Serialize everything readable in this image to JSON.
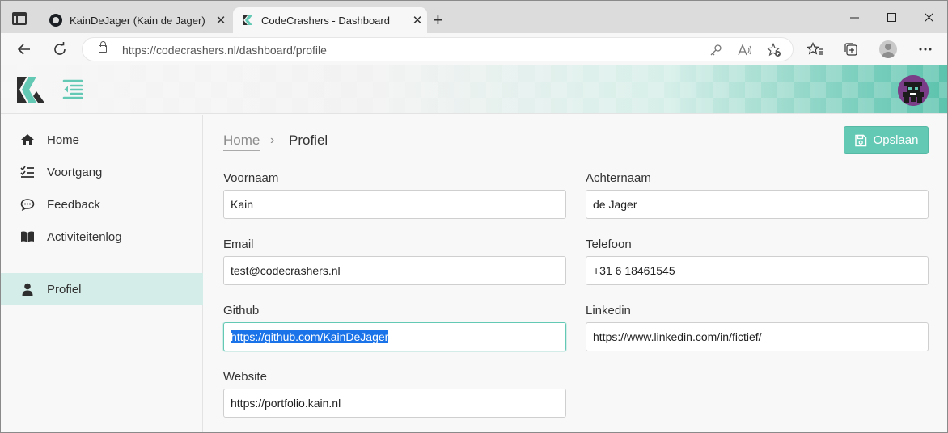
{
  "browser": {
    "tabs": [
      {
        "title": "KainDeJager (Kain de Jager)",
        "icon": "github-icon",
        "active": false
      },
      {
        "title": "CodeCrashers - Dashboard",
        "icon": "codecrashers-icon",
        "active": true
      }
    ],
    "url": "https://codecrashers.nl/dashboard/profile",
    "new_tab_symbol": "+",
    "close_symbol": "✕",
    "window_controls": {
      "minimize": "—",
      "maximize": "☐",
      "close": "✕"
    }
  },
  "colors": {
    "accent": "#63c8b4",
    "sidebar_active": "#d4ede8",
    "avatar_bg": "#7a3d87"
  },
  "sidebar": {
    "items": [
      {
        "label": "Home",
        "icon": "home-icon"
      },
      {
        "label": "Voortgang",
        "icon": "progress-list-icon"
      },
      {
        "label": "Feedback",
        "icon": "chat-icon"
      },
      {
        "label": "Activiteitenlog",
        "icon": "book-icon"
      },
      {
        "label": "Profiel",
        "icon": "user-icon",
        "active": true
      }
    ]
  },
  "breadcrumb": {
    "home": "Home",
    "separator": "›",
    "current": "Profiel"
  },
  "toolbar": {
    "save_label": "Opslaan"
  },
  "form": {
    "voornaam": {
      "label": "Voornaam",
      "value": "Kain"
    },
    "achternaam": {
      "label": "Achternaam",
      "value": "de Jager"
    },
    "email": {
      "label": "Email",
      "value": "test@codecrashers.nl"
    },
    "telefoon": {
      "label": "Telefoon",
      "value": "+31 6 18461545"
    },
    "github": {
      "label": "Github",
      "value": "https://github.com/KainDeJager"
    },
    "linkedin": {
      "label": "Linkedin",
      "value": "https://www.linkedin.com/in/fictief/"
    },
    "website": {
      "label": "Website",
      "value": "https://portfolio.kain.nl"
    }
  }
}
